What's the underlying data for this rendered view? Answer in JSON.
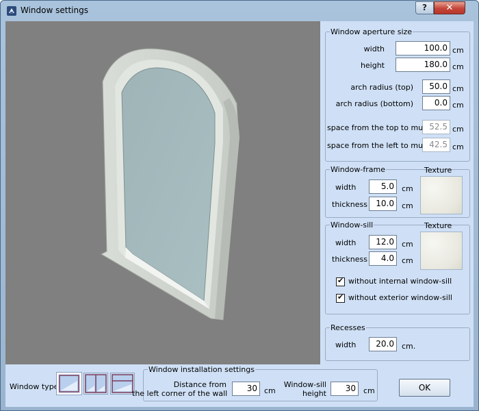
{
  "window": {
    "title": "Window settings",
    "help_glyph": "?",
    "close_glyph": "✕"
  },
  "aperture": {
    "legend": "Window aperture size",
    "width_label": "width",
    "width_value": "100.0",
    "height_label": "height",
    "height_value": "180.0",
    "arch_top_label": "arch radius (top)",
    "arch_top_value": "50.0",
    "arch_bottom_label": "arch radius (bottom)",
    "arch_bottom_value": "0.0",
    "top_muntin_label": "space from the top to muntin",
    "top_muntin_value": "52.5",
    "left_muntin_label": "space from the left to muntin",
    "left_muntin_value": "42.5",
    "unit": "cm"
  },
  "frame": {
    "legend": "Window-frame",
    "texture_label": "Texture",
    "width_label": "width",
    "width_value": "5.0",
    "thickness_label": "thickness",
    "thickness_value": "10.0",
    "unit": "cm"
  },
  "sill": {
    "legend": "Window-sill",
    "texture_label": "Texture",
    "width_label": "width",
    "width_value": "12.0",
    "thickness_label": "thickness",
    "thickness_value": "4.0",
    "unit": "cm",
    "internal_label": "without internal window-sill",
    "internal_checked": true,
    "exterior_label": "without exterior window-sill",
    "exterior_checked": true
  },
  "recesses": {
    "legend": "Recesses",
    "width_label": "width",
    "width_value": "20.0",
    "unit": "cm."
  },
  "bottom": {
    "window_type_label": "Window type",
    "install_legend": "Window installation settings",
    "distance_label_1": "Distance from",
    "distance_label_2": "the left corner of the wall",
    "distance_value": "30",
    "sill_height_label_1": "Window-sill",
    "sill_height_label_2": "height",
    "sill_height_value": "30",
    "unit": "cm",
    "ok_label": "OK"
  },
  "icons": [
    "app-icon",
    "help-icon",
    "close-icon",
    "window-type-single-icon",
    "window-type-double-icon",
    "window-type-split-icon",
    "checkbox-check-icon"
  ]
}
